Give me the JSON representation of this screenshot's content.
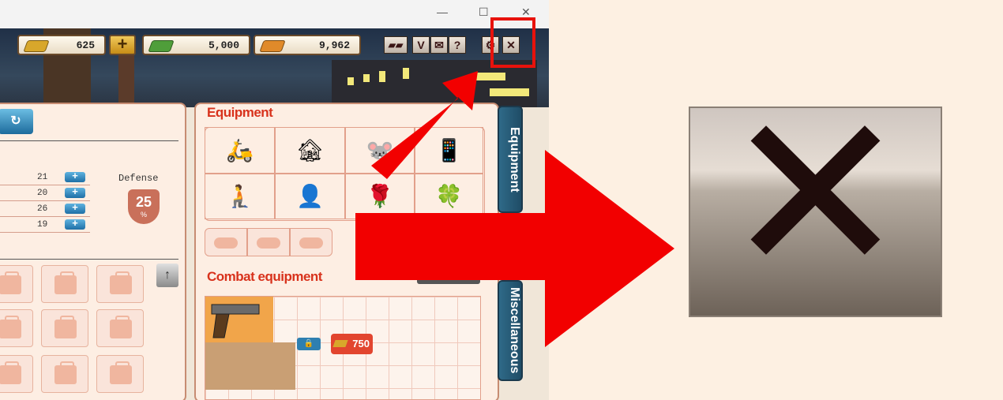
{
  "window": {
    "minimize_icon": "minimize-icon",
    "maximize_icon": "maximize-icon",
    "close_icon": "close-icon"
  },
  "toolbar": {
    "gold_value": "625",
    "cash_value": "5,000",
    "bullets_value": "9,962",
    "plus_label": "+",
    "buttons": [
      "chat-icon",
      "dropdown-icon",
      "mail-icon",
      "help-icon",
      "settings-icon",
      "close-icon"
    ],
    "chevron_label": "V",
    "help_label": "?",
    "close_label": "✕"
  },
  "left_panel": {
    "defense_label": "Defense",
    "defense_value": "25",
    "defense_unit": "%",
    "stats": [
      "21",
      "20",
      "26",
      "19"
    ]
  },
  "equipment": {
    "title": "Equipment",
    "items": [
      "🛵",
      "🏚",
      "🐭",
      "📱",
      "🧎",
      "👤",
      "🌹",
      "🍀"
    ]
  },
  "combat": {
    "title": "Combat equipment",
    "price": "750"
  },
  "tabs": {
    "equipment": "Equipment",
    "miscellaneous": "Miscellaneous"
  },
  "zoom": {
    "close_glyph": "✕"
  },
  "colors": {
    "highlight": "#e8120c",
    "arrow": "#f20000",
    "panel_bg": "#fdeee3",
    "accent_red": "#d8321c",
    "tab_blue": "#1f4c66"
  }
}
